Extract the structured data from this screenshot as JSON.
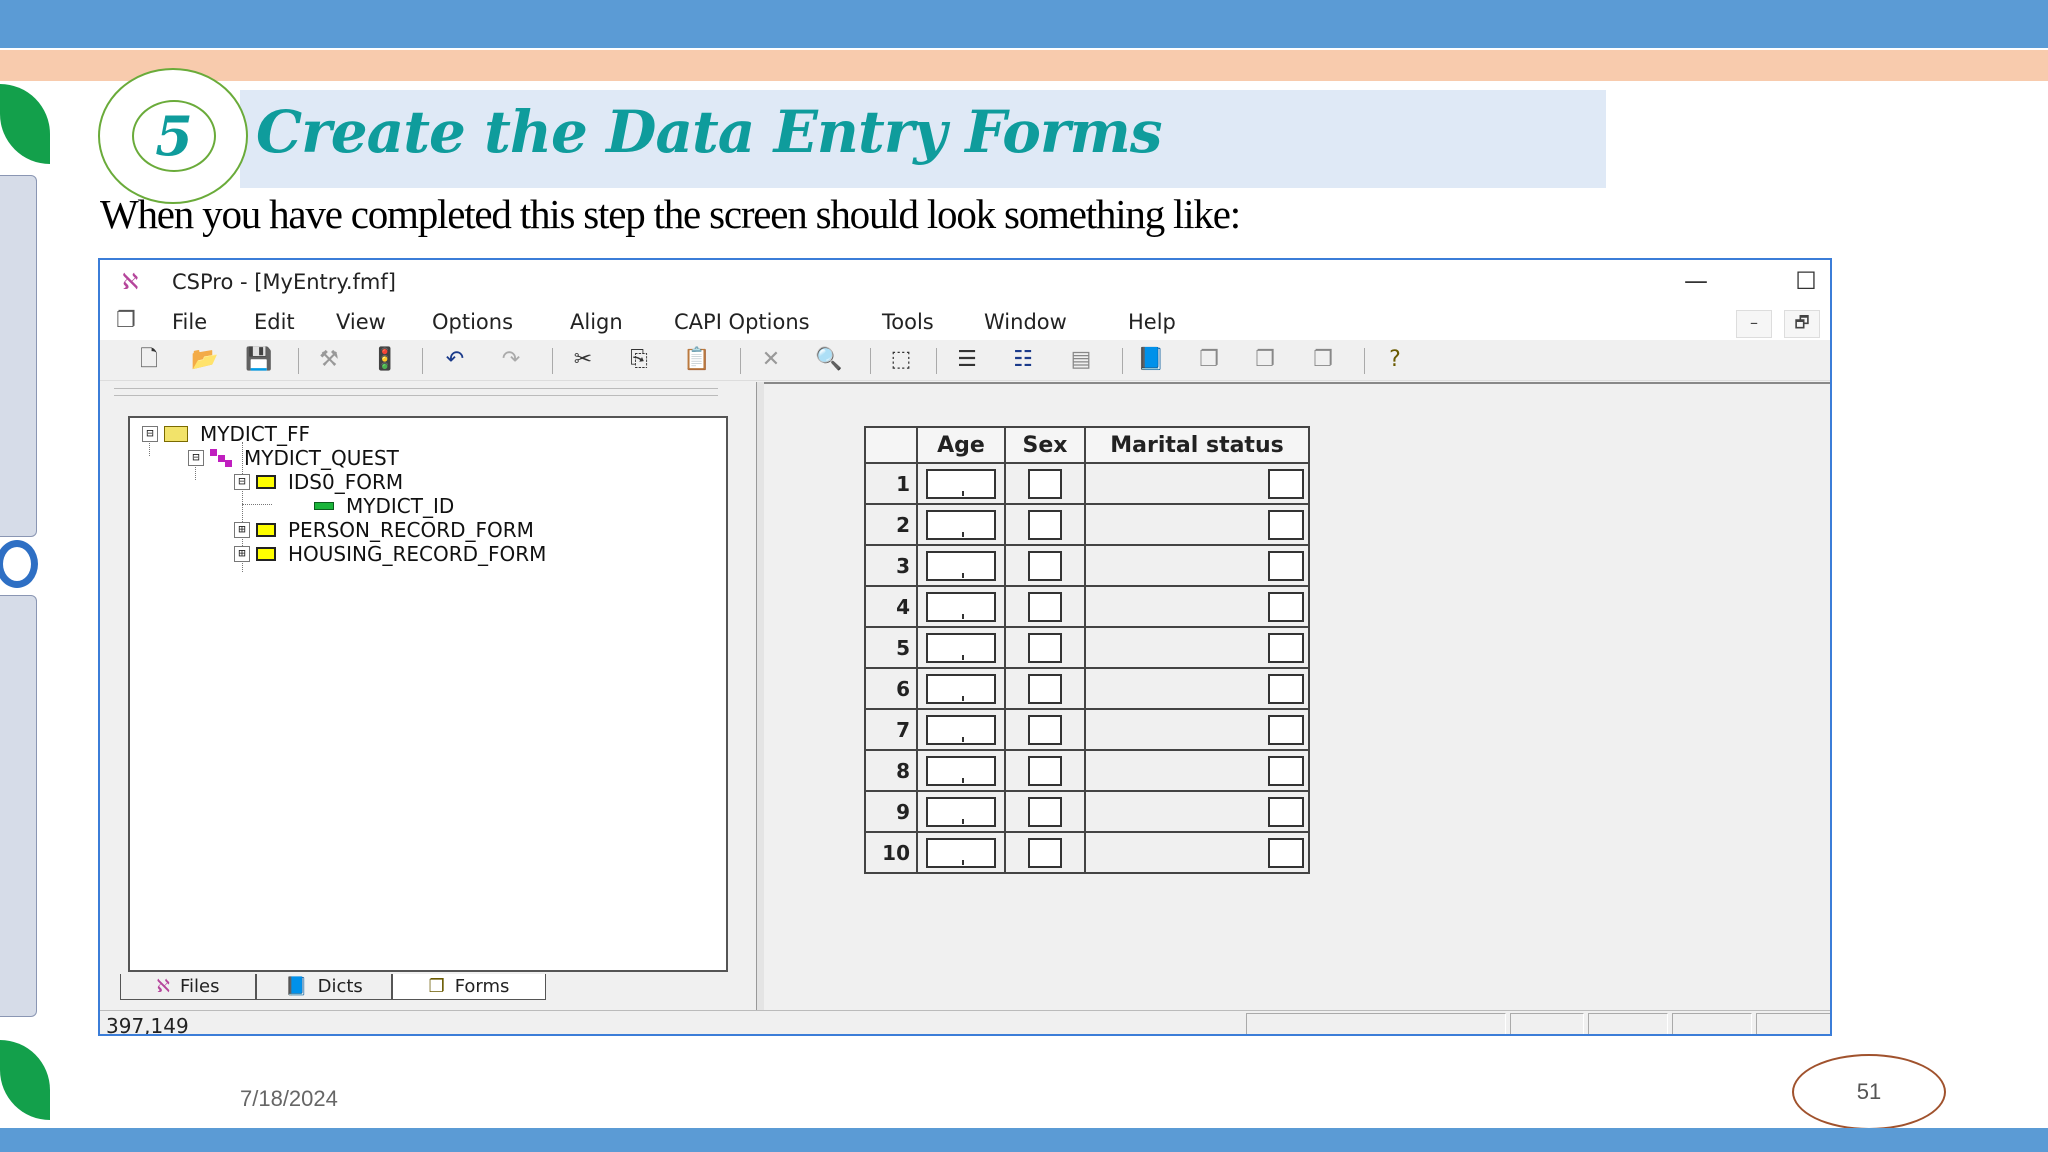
{
  "slide": {
    "step_number": "5",
    "title": "Create the Data Entry Forms",
    "subtitle": "When you have completed this step the screen should look something like:",
    "date": "7/18/2024",
    "page_number": "51"
  },
  "window": {
    "title": "CSPro - [MyEntry.fmf]",
    "controls": {
      "minimize": "—",
      "maximize": "☐",
      "close": "✕"
    },
    "menu": [
      "File",
      "Edit",
      "View",
      "Options",
      "Align",
      "CAPI Options",
      "Tools",
      "Window",
      "Help"
    ],
    "mdi_controls": {
      "minimize": "–",
      "restore": "🗗"
    },
    "toolbar_icons": [
      "new-file-icon",
      "open-folder-icon",
      "save-icon",
      "generate-icon",
      "run-traffic-light-icon",
      "undo-icon",
      "redo-icon",
      "cut-icon",
      "copy-icon",
      "paste-icon",
      "delete-icon",
      "find-icon",
      "select-box-icon",
      "align-left-icon",
      "align-tree-icon",
      "grid-icon",
      "book-icon",
      "forms-stack-icon",
      "forms-stack-2-icon",
      "forms-stack-3-icon",
      "help-icon"
    ]
  },
  "tree": {
    "items": [
      {
        "label": "MYDICT_FF",
        "expander": "⊟",
        "type": "folder"
      },
      {
        "label": "MYDICT_QUEST",
        "expander": "⊟",
        "type": "level"
      },
      {
        "label": "IDS0_FORM",
        "expander": "⊟",
        "type": "form"
      },
      {
        "label": "MYDICT_ID",
        "expander": "",
        "type": "field"
      },
      {
        "label": "PERSON_RECORD_FORM",
        "expander": "⊞",
        "type": "form"
      },
      {
        "label": "HOUSING_RECORD_FORM",
        "expander": "⊞",
        "type": "form"
      }
    ]
  },
  "tabs": [
    {
      "label": "Files",
      "icon": "files-icon"
    },
    {
      "label": "Dicts",
      "icon": "dicts-icon"
    },
    {
      "label": "Forms",
      "icon": "forms-icon"
    }
  ],
  "roster": {
    "columns": [
      "Age",
      "Sex",
      "Marital status"
    ],
    "rows": [
      "1",
      "2",
      "3",
      "4",
      "5",
      "6",
      "7",
      "8",
      "9",
      "10"
    ]
  },
  "status": {
    "coords": "397,149"
  }
}
